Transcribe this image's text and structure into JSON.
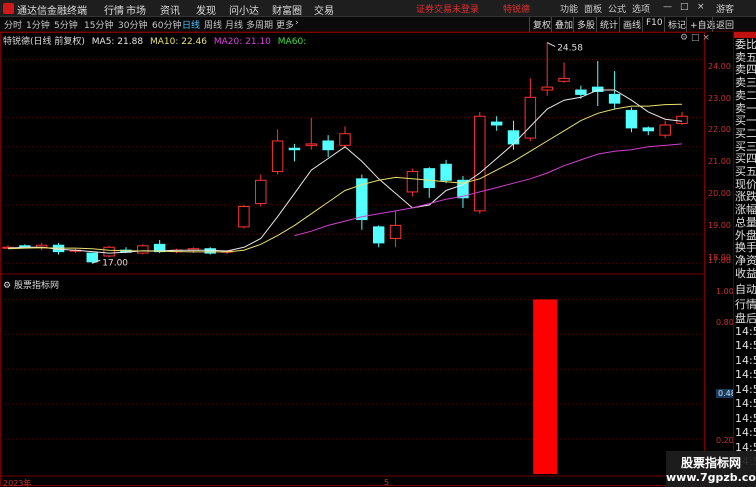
{
  "app": {
    "name": "通达信金融终端",
    "menus": [
      "行情",
      "市场",
      "资讯",
      "发现",
      "问小达",
      "财富圈",
      "交易"
    ],
    "alert": "证券交易未登录",
    "stock_name": "特锐德",
    "right_menus": [
      "功能",
      "面板",
      "公式",
      "选项"
    ],
    "guest": "游客",
    "brand_color": "#d01818"
  },
  "toolbar": {
    "periods": [
      "分时",
      "1分钟",
      "5分钟",
      "15分钟",
      "30分钟",
      "60分钟",
      "日线",
      "周线",
      "月线",
      "多周期",
      "更多"
    ],
    "active": "日线",
    "more_arrow": "›",
    "right_buttons": [
      "复权",
      "叠加",
      "多股",
      "统计",
      "画线",
      "F10",
      "标记",
      "+自选",
      "返回"
    ]
  },
  "chart_info": {
    "title": "特锐德(日线 前复权)",
    "ma5": "MA5: 21.88",
    "ma10": "MA10: 22.46",
    "ma20": "MA20: 21.10",
    "ma60": "MA60: "
  },
  "sub_chart": {
    "title": "股票指标网"
  },
  "right_panel": {
    "labels_top": [
      "委比",
      "卖五",
      "卖四",
      "卖三",
      "卖二",
      "卖一",
      "买一",
      "买二",
      "买三",
      "买四",
      "买五",
      "现价",
      "涨跌",
      "涨幅",
      "总量",
      "外盘",
      "换手",
      "净资",
      "收益"
    ],
    "labels_bottom": [
      "自动",
      "行情",
      "盘后",
      "14:5",
      "14:5",
      "14:5",
      "14:5",
      "14:5",
      "14:5",
      "14:5",
      "14:5",
      "14:5",
      "14:5"
    ]
  },
  "axis": {
    "main_ticks": [
      "24.00",
      "23.00",
      "22.00",
      "21.00",
      "20.00",
      "19.00",
      "18.00",
      "17.00"
    ],
    "sub_ticks": [
      "1.00",
      "0.80",
      "0.48",
      "0.20"
    ],
    "x_labels": [
      "2023年",
      "5"
    ]
  },
  "watermark": {
    "line1": "股票指标网",
    "line2": "www.7gpzb.com"
  },
  "chart_data": [
    {
      "type": "candlestick",
      "title": "特锐德(日线 前复权)",
      "ylim": [
        16.7,
        24.6
      ],
      "annotations": [
        {
          "label": "24.58",
          "value": 24.58
        },
        {
          "label": "17.00",
          "value": 17.0
        }
      ],
      "candles": [
        {
          "o": 17.55,
          "h": 17.62,
          "l": 17.5,
          "c": 17.55
        },
        {
          "o": 17.6,
          "h": 17.65,
          "l": 17.55,
          "c": 17.58
        },
        {
          "o": 17.55,
          "h": 17.7,
          "l": 17.45,
          "c": 17.62
        },
        {
          "o": 17.62,
          "h": 17.7,
          "l": 17.3,
          "c": 17.4
        },
        {
          "o": 17.42,
          "h": 17.5,
          "l": 17.35,
          "c": 17.45
        },
        {
          "o": 17.35,
          "h": 17.35,
          "l": 17.0,
          "c": 17.05
        },
        {
          "o": 17.25,
          "h": 17.6,
          "l": 17.2,
          "c": 17.55
        },
        {
          "o": 17.45,
          "h": 17.55,
          "l": 17.35,
          "c": 17.38
        },
        {
          "o": 17.35,
          "h": 17.65,
          "l": 17.3,
          "c": 17.6
        },
        {
          "o": 17.65,
          "h": 17.8,
          "l": 17.35,
          "c": 17.4
        },
        {
          "o": 17.4,
          "h": 17.5,
          "l": 17.35,
          "c": 17.45
        },
        {
          "o": 17.45,
          "h": 17.55,
          "l": 17.35,
          "c": 17.5
        },
        {
          "o": 17.5,
          "h": 17.55,
          "l": 17.3,
          "c": 17.35
        },
        {
          "o": 17.38,
          "h": 17.45,
          "l": 17.32,
          "c": 17.42
        },
        {
          "o": 18.25,
          "h": 19.0,
          "l": 18.2,
          "c": 18.95
        },
        {
          "o": 19.05,
          "h": 20.05,
          "l": 18.95,
          "c": 19.85
        },
        {
          "o": 20.15,
          "h": 21.6,
          "l": 20.05,
          "c": 21.2
        },
        {
          "o": 20.95,
          "h": 21.1,
          "l": 20.5,
          "c": 20.9
        },
        {
          "o": 21.05,
          "h": 22.0,
          "l": 20.9,
          "c": 21.1
        },
        {
          "o": 21.2,
          "h": 21.4,
          "l": 20.65,
          "c": 20.9
        },
        {
          "o": 21.05,
          "h": 21.7,
          "l": 20.95,
          "c": 21.45
        },
        {
          "o": 19.9,
          "h": 20.05,
          "l": 18.15,
          "c": 18.5
        },
        {
          "o": 18.25,
          "h": 18.3,
          "l": 17.55,
          "c": 17.7
        },
        {
          "o": 17.85,
          "h": 18.8,
          "l": 17.55,
          "c": 18.3
        },
        {
          "o": 19.45,
          "h": 20.25,
          "l": 19.3,
          "c": 20.15
        },
        {
          "o": 20.25,
          "h": 20.3,
          "l": 19.25,
          "c": 19.6
        },
        {
          "o": 20.4,
          "h": 20.55,
          "l": 19.75,
          "c": 19.85
        },
        {
          "o": 19.85,
          "h": 20.0,
          "l": 18.9,
          "c": 19.25
        },
        {
          "o": 18.8,
          "h": 22.2,
          "l": 18.7,
          "c": 22.05
        },
        {
          "o": 21.85,
          "h": 22.05,
          "l": 21.55,
          "c": 21.75
        },
        {
          "o": 21.55,
          "h": 21.9,
          "l": 20.9,
          "c": 21.1
        },
        {
          "o": 21.3,
          "h": 23.35,
          "l": 21.2,
          "c": 22.7
        },
        {
          "o": 22.95,
          "h": 24.58,
          "l": 22.75,
          "c": 23.05
        },
        {
          "o": 23.25,
          "h": 23.9,
          "l": 23.2,
          "c": 23.35
        },
        {
          "o": 22.95,
          "h": 23.1,
          "l": 22.65,
          "c": 22.8
        },
        {
          "o": 23.05,
          "h": 23.95,
          "l": 22.4,
          "c": 22.9
        },
        {
          "o": 22.8,
          "h": 23.6,
          "l": 22.3,
          "c": 22.5
        },
        {
          "o": 22.25,
          "h": 22.35,
          "l": 21.5,
          "c": 21.65
        },
        {
          "o": 21.65,
          "h": 21.7,
          "l": 21.4,
          "c": 21.55
        },
        {
          "o": 21.4,
          "h": 21.9,
          "l": 21.3,
          "c": 21.75
        },
        {
          "o": 21.8,
          "h": 22.2,
          "l": 21.75,
          "c": 22.05
        }
      ],
      "series": [
        {
          "name": "MA5",
          "values": [
            17.52,
            17.55,
            17.55,
            17.48,
            17.45,
            17.4,
            17.35,
            17.38,
            17.43,
            17.42,
            17.45,
            17.45,
            17.45,
            17.42,
            17.55,
            17.85,
            18.6,
            19.4,
            20.2,
            20.6,
            21.0,
            20.5,
            19.9,
            19.4,
            18.9,
            19.0,
            19.5,
            19.7,
            20.1,
            20.6,
            21.1,
            21.7,
            22.3,
            22.6,
            22.7,
            22.95,
            22.95,
            22.6,
            22.2,
            21.95,
            21.88
          ]
        },
        {
          "name": "MA10",
          "values": [
            17.5,
            17.52,
            17.53,
            17.52,
            17.52,
            17.5,
            17.45,
            17.43,
            17.42,
            17.41,
            17.4,
            17.39,
            17.39,
            17.39,
            17.45,
            17.65,
            17.95,
            18.3,
            18.7,
            19.1,
            19.5,
            19.7,
            19.85,
            19.95,
            19.9,
            19.85,
            19.8,
            19.75,
            19.9,
            20.2,
            20.5,
            20.85,
            21.2,
            21.55,
            21.9,
            22.15,
            22.3,
            22.4,
            22.4,
            22.45,
            22.46
          ]
        },
        {
          "name": "MA20",
          "values": [
            null,
            null,
            null,
            null,
            null,
            null,
            null,
            null,
            null,
            null,
            null,
            null,
            null,
            null,
            null,
            null,
            null,
            17.95,
            18.1,
            18.3,
            18.45,
            18.6,
            18.7,
            18.8,
            18.9,
            19.05,
            19.2,
            19.3,
            19.45,
            19.6,
            19.75,
            19.9,
            20.1,
            20.35,
            20.55,
            20.75,
            20.85,
            20.9,
            21.0,
            21.05,
            21.1
          ]
        }
      ]
    },
    {
      "type": "bar",
      "title": "股票指标网",
      "ylim": [
        0,
        1.1
      ],
      "categories": [
        "signal"
      ],
      "values": [
        1.0
      ]
    }
  ]
}
